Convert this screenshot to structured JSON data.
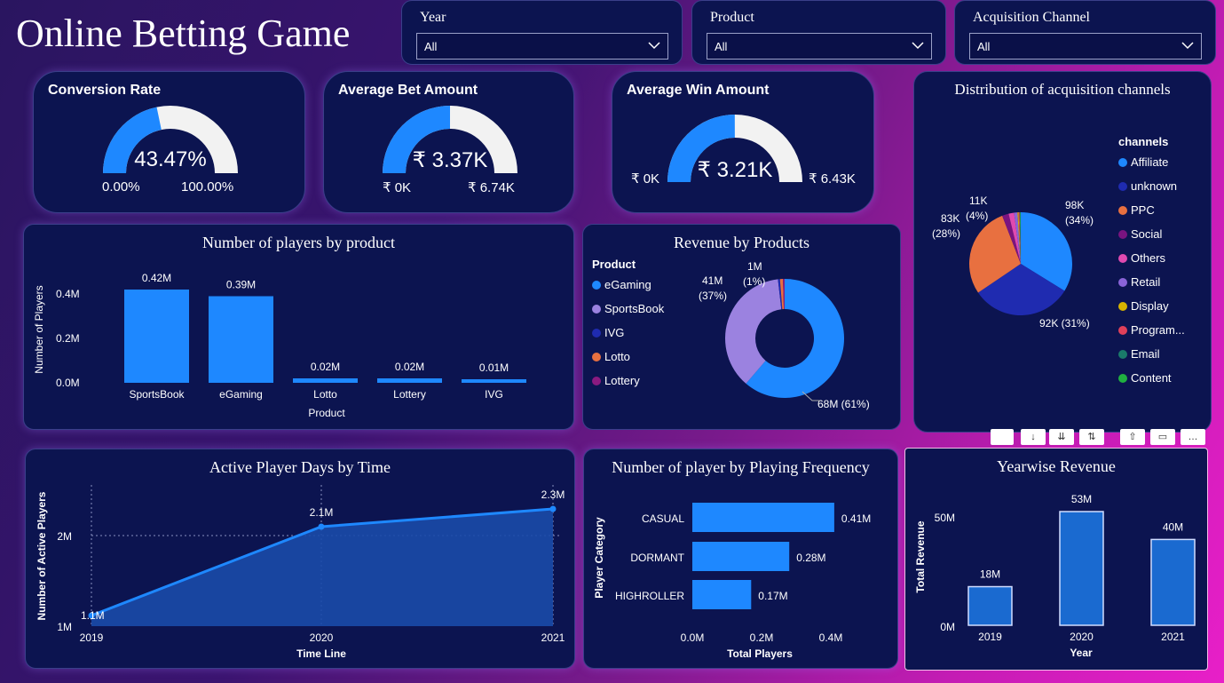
{
  "title": "Online Betting Game",
  "filters": [
    {
      "label": "Year",
      "value": "All"
    },
    {
      "label": "Product",
      "value": "All"
    },
    {
      "label": "Acquisition Channel",
      "value": "All"
    }
  ],
  "kpis": {
    "conversion": {
      "title": "Conversion Rate",
      "value": "43.47%",
      "min": "0.00%",
      "max": "100.00%",
      "fraction": 0.4347
    },
    "avg_bet": {
      "title": "Average Bet Amount",
      "value": "₹ 3.37K",
      "min": "₹ 0K",
      "max": "₹ 6.74K",
      "fraction": 0.5
    },
    "avg_win": {
      "title": "Average Win Amount",
      "value": "₹ 3.21K",
      "min": "₹ 0K",
      "max": "₹ 6.43K",
      "fraction": 0.4992
    }
  },
  "colors": {
    "blue": "#1e88ff",
    "gauge_bg": "#f2f2f2",
    "card": "#0c1450",
    "navy": "#1f2bb0",
    "purple": "#9b82e0",
    "orange": "#e87040",
    "magenta": "#e04ab0",
    "darkpurple": "#8a1a80"
  },
  "chart_data": [
    {
      "type": "bar",
      "title": "Number of players by product",
      "xlabel": "Product",
      "ylabel": "Number of Players",
      "categories": [
        "SportsBook",
        "eGaming",
        "Lotto",
        "Lottery",
        "IVG"
      ],
      "values": [
        0.42,
        0.39,
        0.02,
        0.02,
        0.01
      ],
      "data_labels": [
        "0.42M",
        "0.39M",
        "0.02M",
        "0.02M",
        "0.01M"
      ],
      "yticks": [
        "0.0M",
        "0.2M",
        "0.4M"
      ],
      "ylim": [
        0,
        0.42
      ]
    },
    {
      "type": "pie",
      "title": "Revenue by Products",
      "legend_title": "Product",
      "legend": [
        "eGaming",
        "SportsBook",
        "IVG",
        "Lotto",
        "Lottery"
      ],
      "slices": [
        {
          "name": "eGaming",
          "value": 68,
          "label": "68M (61%)",
          "color": "#1e88ff"
        },
        {
          "name": "SportsBook",
          "value": 41,
          "label": "41M (37%)",
          "color": "#9b82e0"
        },
        {
          "name": "IVG",
          "value": 0.6,
          "label": "",
          "color": "#1f2bb0"
        },
        {
          "name": "Lotto",
          "value": 0.9,
          "label": "1M (1%)",
          "color": "#e87040"
        },
        {
          "name": "Lottery",
          "value": 0.5,
          "label": "",
          "color": "#8a1a80"
        }
      ]
    },
    {
      "type": "pie",
      "title": "Distribution of acquisition channels",
      "legend_title": "channels",
      "legend": [
        "Affiliate",
        "unknown",
        "PPC",
        "Social",
        "Others",
        "Retail",
        "Display",
        "Program...",
        "Email",
        "Content"
      ],
      "legend_colors": [
        "#1e88ff",
        "#1f2bb0",
        "#e87040",
        "#7a1480",
        "#e04ab0",
        "#8a64d8",
        "#d8b400",
        "#e0405a",
        "#1a7a6a",
        "#20b040"
      ],
      "slices": [
        {
          "name": "Affiliate",
          "value": 98,
          "label": "98K (34%)",
          "color": "#1e88ff"
        },
        {
          "name": "unknown",
          "value": 92,
          "label": "92K (31%)",
          "color": "#1f2bb0"
        },
        {
          "name": "PPC",
          "value": 83,
          "label": "83K (28%)",
          "color": "#e87040"
        },
        {
          "name": "Social",
          "value": 6,
          "label": "",
          "color": "#7a1480"
        },
        {
          "name": "Others",
          "value": 5,
          "label": "11K (4%)",
          "color": "#e04ab0"
        },
        {
          "name": "Retail",
          "value": 3,
          "label": "",
          "color": "#8a64d8"
        },
        {
          "name": "Display",
          "value": 1,
          "label": "",
          "color": "#d8b400"
        },
        {
          "name": "Program...",
          "value": 1,
          "label": "",
          "color": "#e0405a"
        },
        {
          "name": "Email",
          "value": 0.5,
          "label": "",
          "color": "#1a7a6a"
        },
        {
          "name": "Content",
          "value": 0.5,
          "label": "",
          "color": "#20b040"
        }
      ]
    },
    {
      "type": "area",
      "title": "Active Player Days by Time",
      "xlabel": "Time Line",
      "ylabel": "Number of Active Players",
      "x": [
        "2019",
        "2020",
        "2021"
      ],
      "values": [
        1.1,
        2.1,
        2.3
      ],
      "data_labels": [
        "1.1M",
        "2.1M",
        "2.3M"
      ],
      "yticks": [
        "1M",
        "2M"
      ],
      "ylim": [
        1,
        2.5
      ]
    },
    {
      "type": "bar",
      "orientation": "horizontal",
      "title": "Number of player by Playing Frequency",
      "xlabel": "Total Players",
      "ylabel": "Player Category",
      "categories": [
        "CASUAL",
        "DORMANT",
        "HIGHROLLER"
      ],
      "values": [
        0.41,
        0.28,
        0.17
      ],
      "data_labels": [
        "0.41M",
        "0.28M",
        "0.17M"
      ],
      "xticks": [
        "0.0M",
        "0.2M",
        "0.4M"
      ],
      "xlim": [
        0,
        0.4
      ]
    },
    {
      "type": "bar",
      "title": "Yearwise Revenue",
      "xlabel": "Year",
      "ylabel": "Total Revenue",
      "categories": [
        "2019",
        "2020",
        "2021"
      ],
      "values": [
        18,
        53,
        40
      ],
      "data_labels": [
        "18M",
        "53M",
        "40M"
      ],
      "yticks": [
        "0M",
        "50M"
      ],
      "ylim": [
        0,
        53
      ]
    }
  ]
}
